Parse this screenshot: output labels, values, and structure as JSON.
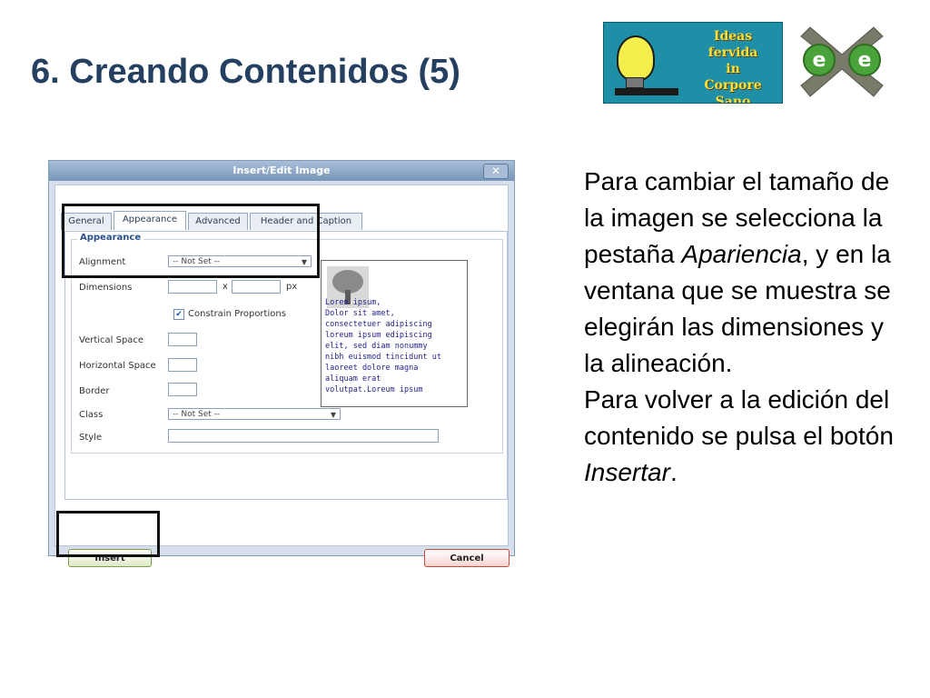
{
  "slide": {
    "title": "6. Creando Contenidos (5)",
    "para1_before": "Para cambiar el tamaño de la imagen se selecciona la pestaña ",
    "para1_italic": "Apariencia",
    "para1_after": ", y en la ventana que se muestra se elegirán las dimensiones y la alineación.",
    "para2_before": "Para volver a la edición del contenido se pulsa el botón ",
    "para2_italic": "Insertar",
    "para2_after": "."
  },
  "logos": {
    "ideas_text_1": "Ideas",
    "ideas_text_2": "fervida",
    "ideas_text_3": "in",
    "ideas_text_4": "Corpore Sano",
    "ee_text_1": "e",
    "ee_text_2": "e",
    "colors": {
      "ideas_bg": "#1f8fa8",
      "ideas_text": "#f6e03a",
      "ee_green": "#4aa23a",
      "ee_x": "#7a7a6a"
    }
  },
  "dialog": {
    "title": "Insert/Edit Image",
    "close_label": "✕",
    "tabs": [
      "General",
      "Appearance",
      "Advanced",
      "Header and Caption"
    ],
    "active_tab": "Appearance",
    "legend": "Appearance",
    "alignment_label": "Alignment",
    "alignment_value": "-- Not Set --",
    "dimensions_label": "Dimensions",
    "dimensions_x": "x",
    "dimensions_unit": "px",
    "constrain_label": "Constrain Proportions",
    "constrain_checked": true,
    "vspace_label": "Vertical Space",
    "hspace_label": "Horizontal Space",
    "border_label": "Border",
    "class_label": "Class",
    "class_value": "-- Not Set --",
    "style_label": "Style",
    "preview_text": "Lorem ipsum,\nDolor sit amet,\nconsectetuer adipiscing\nloreum ipsum edipiscing\nelit, sed diam nonummy\nnibh euismod tincidunt ut\nlaoreet dolore magna\naliquam erat\nvolutpat.Loreum ipsum",
    "insert_label": "Insert",
    "cancel_label": "Cancel"
  }
}
